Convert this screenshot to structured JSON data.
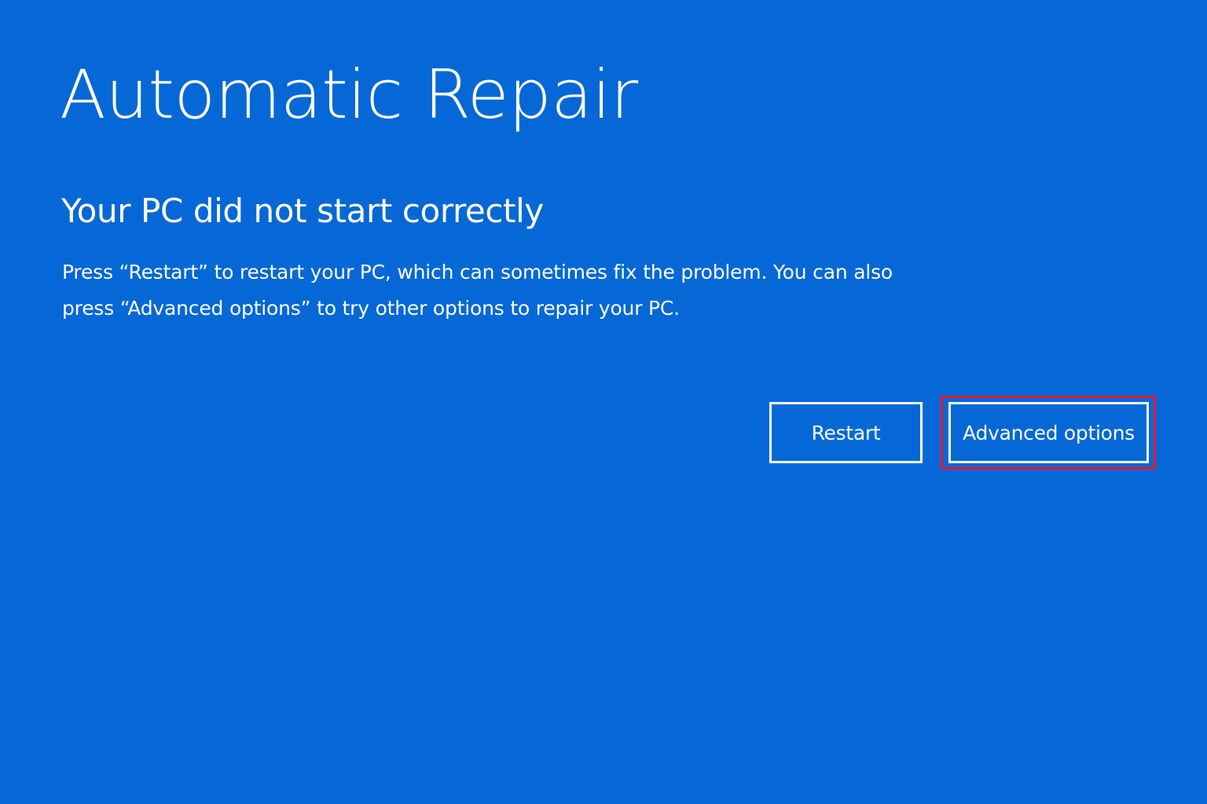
{
  "screen": {
    "title": "Automatic Repair",
    "subtitle": "Your PC did not start correctly",
    "message": "Press “Restart” to restart your PC, which can sometimes fix the problem. You can also press “Advanced options” to try other options to repair your PC."
  },
  "buttons": {
    "restart_label": "Restart",
    "advanced_label": "Advanced options"
  },
  "colors": {
    "background": "#0568d6",
    "text": "#ffffff",
    "highlight": "#e8172e"
  }
}
